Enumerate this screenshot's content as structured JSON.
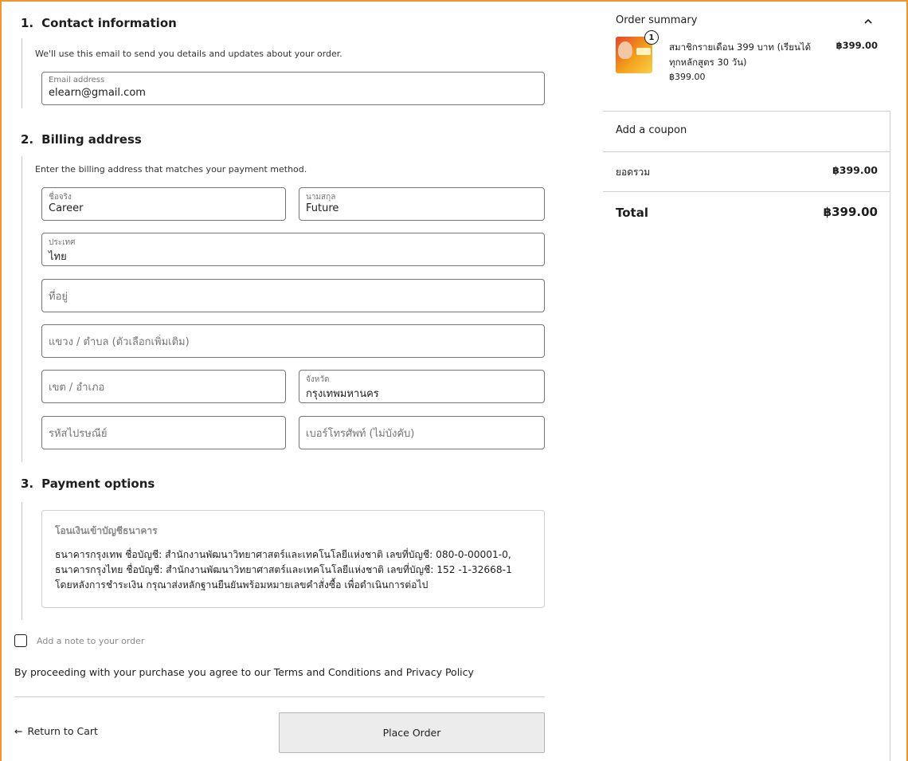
{
  "contact": {
    "number": "1.",
    "title": "Contact information",
    "helper": "We'll use this email to send you details and updates about your order.",
    "email_label": "Email address",
    "email_value": "elearn@gmail.com"
  },
  "billing": {
    "number": "2.",
    "title": "Billing address",
    "helper": "Enter the billing address that matches your payment method.",
    "first_name_label": "ชื่อจริง",
    "first_name_value": "Career",
    "last_name_label": "นามสกุล",
    "last_name_value": "Future",
    "country_label": "ประเทศ",
    "country_value": "ไทย",
    "address_placeholder": "ที่อยู่",
    "subdistrict_placeholder": "แขวง / ตำบล (ตัวเลือกเพิ่มเติม)",
    "district_placeholder": "เขต / อำเภอ",
    "province_label": "จังหวัด",
    "province_value": "กรุงเทพมหานคร",
    "postcode_placeholder": "รหัสไปรษณีย์",
    "phone_placeholder": "เบอร์โทรศัพท์ (ไม่บังคับ)"
  },
  "payment": {
    "number": "3.",
    "title": "Payment options",
    "method_title": "โอนเงินเข้าบัญชีธนาคาร",
    "line1": "ธนาคารกรุงเทพ ชื่อบัญชี: สำนักงานพัฒนาวิทยาศาสตร์และเทคโนโลยีแห่งชาติ เลขที่บัญชี: 080-0-00001-0,",
    "line2": "ธนาคารกรุงไทย ชื่อบัญชี: สำนักงานพัฒนาวิทยาศาสตร์และเทคโนโลยีแห่งชาติ เลขที่บัญชี: 152 -1-32668-1",
    "line3": "โดยหลังการชำระเงิน กรุณาส่งหลักฐานยืนยันพร้อมหมายเลขคำสั่งซื้อ เพื่อดำเนินการต่อไป"
  },
  "order_note": {
    "label": "Add a note to your order"
  },
  "terms": {
    "prefix": "By proceeding with your purchase you agree to our",
    "terms_link": "Terms and Conditions",
    "and": "and",
    "privacy_link": "Privacy Policy"
  },
  "actions": {
    "return_arrow": "←",
    "return_label": "Return to Cart",
    "place_order_label": "Place Order"
  },
  "summary": {
    "title": "Order summary",
    "item": {
      "quantity": "1",
      "name": "สมาชิกรายเดือน 399 บาท (เรียนได้ทุกหลักสูตร 30 วัน)",
      "unit_price": "฿399.00",
      "line_total": "฿399.00"
    },
    "coupon_label": "Add a coupon",
    "subtotal_label": "ยอดรวม",
    "subtotal_value": "฿399.00",
    "total_label": "Total",
    "total_value": "฿399.00"
  },
  "colors": {
    "frame_accent": "#f0962c",
    "field_border": "#757575",
    "button_bg": "#ececec"
  }
}
